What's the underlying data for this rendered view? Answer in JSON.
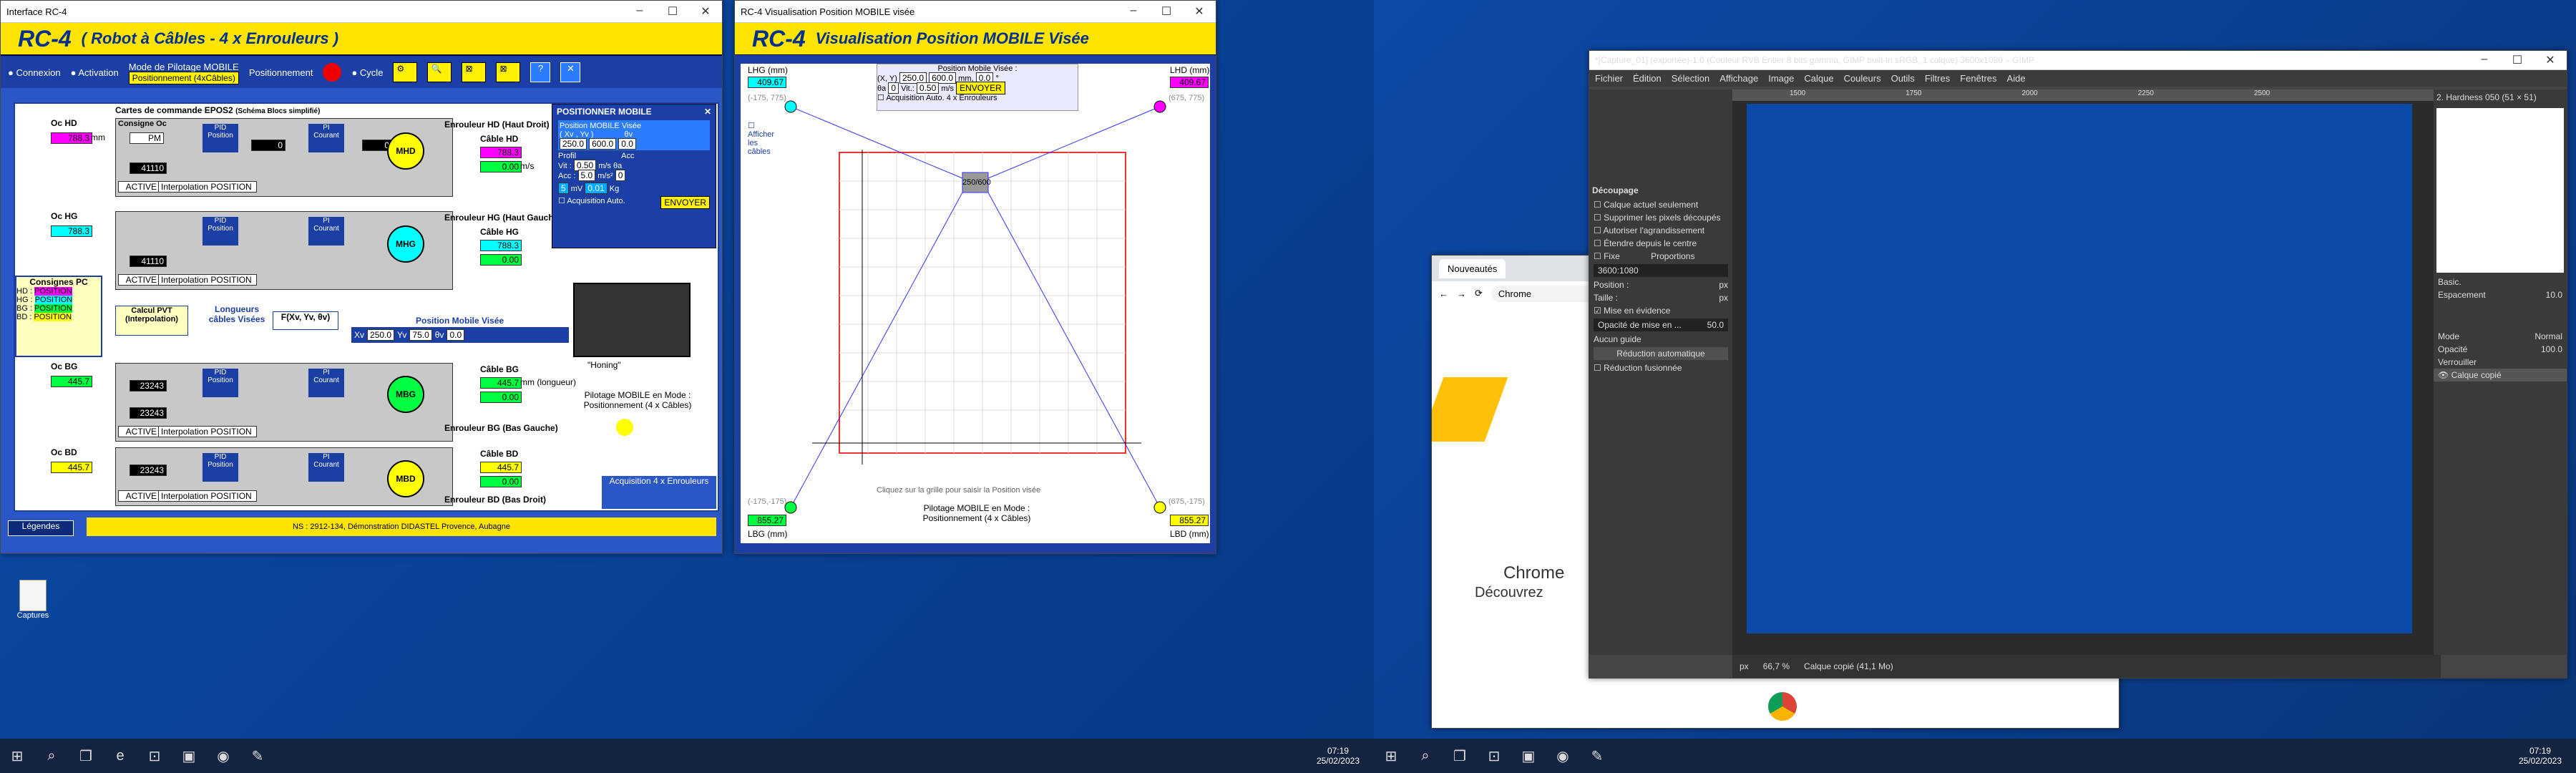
{
  "interface": {
    "window_title": "Interface RC-4",
    "title": "RC-4",
    "subtitle": "( Robot à Câbles - 4 x Enrouleurs )",
    "toolbar": {
      "connexion": "Connexion",
      "activation": "Activation",
      "mode_label": "Mode de Pilotage MOBILE",
      "mode_value": "Positionnement (4xCâbles)",
      "positionnement": "Positionnement",
      "cycle": "Cycle",
      "zero": "0",
      "one": "1"
    },
    "cards_title": "Cartes de commande EPOS2",
    "cards_sub": "(Schéma Blocs simplifié)",
    "oc_hd": "Oc HD",
    "oc_hg": "Oc HG",
    "oc_bg": "Oc BG",
    "oc_bd": "Oc BD",
    "val_hd": "788.3",
    "val_hg": "788.3",
    "val_bg": "445.7",
    "val_bd": "445.7",
    "mm": "mm",
    "consigne_oc": "Consigne Oc",
    "mesure": "Mesure",
    "pid_position": "PID Position",
    "pi_courant": "PI Courant",
    "ic": "Ic",
    "um": "Um",
    "mesures": "Mesures",
    "etat_mode": "Etat / Mode",
    "active": "ACTIVE",
    "interp_pos": "Interpolation POSITION",
    "n41110": "41110",
    "n23243": "23243",
    "enr_hd": "Enrouleur HD (Haut Droit)",
    "enr_hg": "Enrouleur HG (Haut Gauche)",
    "enr_bg": "Enrouleur BG (Bas Gauche)",
    "enr_bd": "Enrouleur BD (Bas Droit)",
    "cable_hd": "Câble HD",
    "cable_hg": "Câble HG",
    "cable_bg": "Câble BG",
    "cable_bd": "Câble BD",
    "l_hd": "788.3",
    "l_hg": "788.3",
    "l_bg": "445.7",
    "l_bd": "445.7",
    "v_zero": "0.00",
    "ms": "m/s",
    "longueur": "mm (longueur)",
    "consignes_pc": "Consignes PC",
    "cpc": [
      {
        "k": "HD :",
        "v": "POSITION"
      },
      {
        "k": "HG :",
        "v": "POSITION"
      },
      {
        "k": "BG :",
        "v": "POSITION"
      },
      {
        "k": "BD :",
        "v": "POSITION"
      }
    ],
    "calcul_pvt": "Calcul PVT (Interpolation)",
    "longueurs": "Longueurs câbles Visées",
    "fxy": "F(Xv, Yv, θv)",
    "pos_mobile_visee": "Position Mobile Visée",
    "xv": "Xv",
    "xv_val": "250.0",
    "yv": "Yv",
    "yv_val": "75.0",
    "thv": "θv",
    "thv_val": "0.0",
    "honing": "\"Honing\"",
    "pilotage": "Pilotage MOBILE en Mode : Positionnement (4 x Câbles)",
    "acquisition": "Acquisition 4 x Enrouleurs",
    "legendes": "Légendes",
    "footer": "NS : 2912-134, Démonstration DIDASTEL Provence, Aubagne",
    "popup": {
      "title": "POSITIONNER MOBILE",
      "pmv": "Position MOBILE Visée",
      "xy": "( Xv , Yv )",
      "theta": "θv",
      "x": "250.0",
      "y": "600.0",
      "th": "0.0",
      "profil": "Profil",
      "acc_lbl": "Acc",
      "vit": "Vit :",
      "vit_val": "0.50",
      "vit_u": "m/s",
      "acc": "Acc :",
      "acc_val": "5.0",
      "acc_u": "m/s²",
      "theta_a": "θa",
      "theta_a_val": "0",
      "mv": "5",
      "mv_u": "mV",
      "kg": "0.01",
      "kg_u": "Kg",
      "acq_auto": "Acquisition Auto.",
      "envoyer": "ENVOYER"
    }
  },
  "visu": {
    "window_title": "RC-4 Visualisation Position MOBILE visée",
    "title": "RC-4",
    "subtitle": "Visualisation Position MOBILE Visée",
    "lhg": "LHG (mm)",
    "lhd": "LHD (mm)",
    "lbg": "LBG (mm)",
    "lbd": "LBD (mm)",
    "lhg_val": "409.67",
    "lhd_val": "409.67",
    "lbg_val": "855.27",
    "lbd_val": "855.27",
    "c_tl": "(-175, 775)",
    "c_tr": "(675, 775)",
    "c_bl": "(-175,-175)",
    "c_br": "(675,-175)",
    "afficher": "Afficher les câbles",
    "pmv": "Position Mobile Visée :",
    "xy": "(X, Y)",
    "x": "250.0",
    "y": "600.0",
    "mm": "mm,",
    "th": "0.0",
    "deg": "°",
    "theta_a": "θa",
    "theta_a_val": "0",
    "vit": "Vit.:",
    "vit_val": "0.50",
    "vit_u": "m/s",
    "envoyer": "ENVOYER",
    "acq": "Acquisition Auto. 4 x Enrouleurs",
    "hint": "Cliquez sur la grille pour saisir la Position visée",
    "pilotage": "Pilotage MOBILE en Mode : Positionnement (4 x Câbles)",
    "mobile": "250/600"
  },
  "gimp": {
    "window_title": "*[Capture_01] (exportée)-1.0 (Couleur RVB Entier 8 bits gamma, GIMP built-in sRGB, 1 calque) 3600x1080 – GIMP",
    "menu": [
      "Fichier",
      "Édition",
      "Sélection",
      "Affichage",
      "Image",
      "Calque",
      "Couleurs",
      "Outils",
      "Filtres",
      "Fenêtres",
      "Aide"
    ],
    "ruler": [
      "1500",
      "1750",
      "2000",
      "2250",
      "2500"
    ],
    "decoupage": "Découpage",
    "options": [
      "Calque actuel seulement",
      "Supprimer les pixels découpés",
      "Autoriser l'agrandissement",
      "Étendre depuis le centre"
    ],
    "fixe": "Fixe",
    "proportions": "Proportions",
    "ratio": "3600:1080",
    "position": "Position :",
    "taille": "Taille :",
    "px": "px",
    "mise_en_evidence": "Mise en évidence",
    "opacite_mise": "Opacité de mise en ...",
    "opacite_val": "50.0",
    "aucun_guide": "Aucun guide",
    "reduction_auto": "Réduction automatique",
    "reduction_fus": "Réduction fusionnée",
    "brush": "2. Hardness 050 (51 × 51)",
    "basic": "Basic.",
    "espacement": "Espacement",
    "espacement_val": "10.0",
    "mode": "Mode",
    "mode_val": "Normal",
    "opacite": "Opacité",
    "opacite_layer": "100.0",
    "verrouiller": "Verrouiller",
    "calque": "Calque copié",
    "status": "Calque copié (41,1 Mo)",
    "zoom": "66,7 %"
  },
  "chrome": {
    "tab": "Nouveautés",
    "addr": "Chrome",
    "heading": "Chrome",
    "text": "Découvrez"
  },
  "desktop": {
    "icon_label": "Captures"
  },
  "taskbar": {
    "time1": "07:19",
    "date1": "25/02/2023",
    "time2": "07:19",
    "date2": "25/02/2023"
  }
}
